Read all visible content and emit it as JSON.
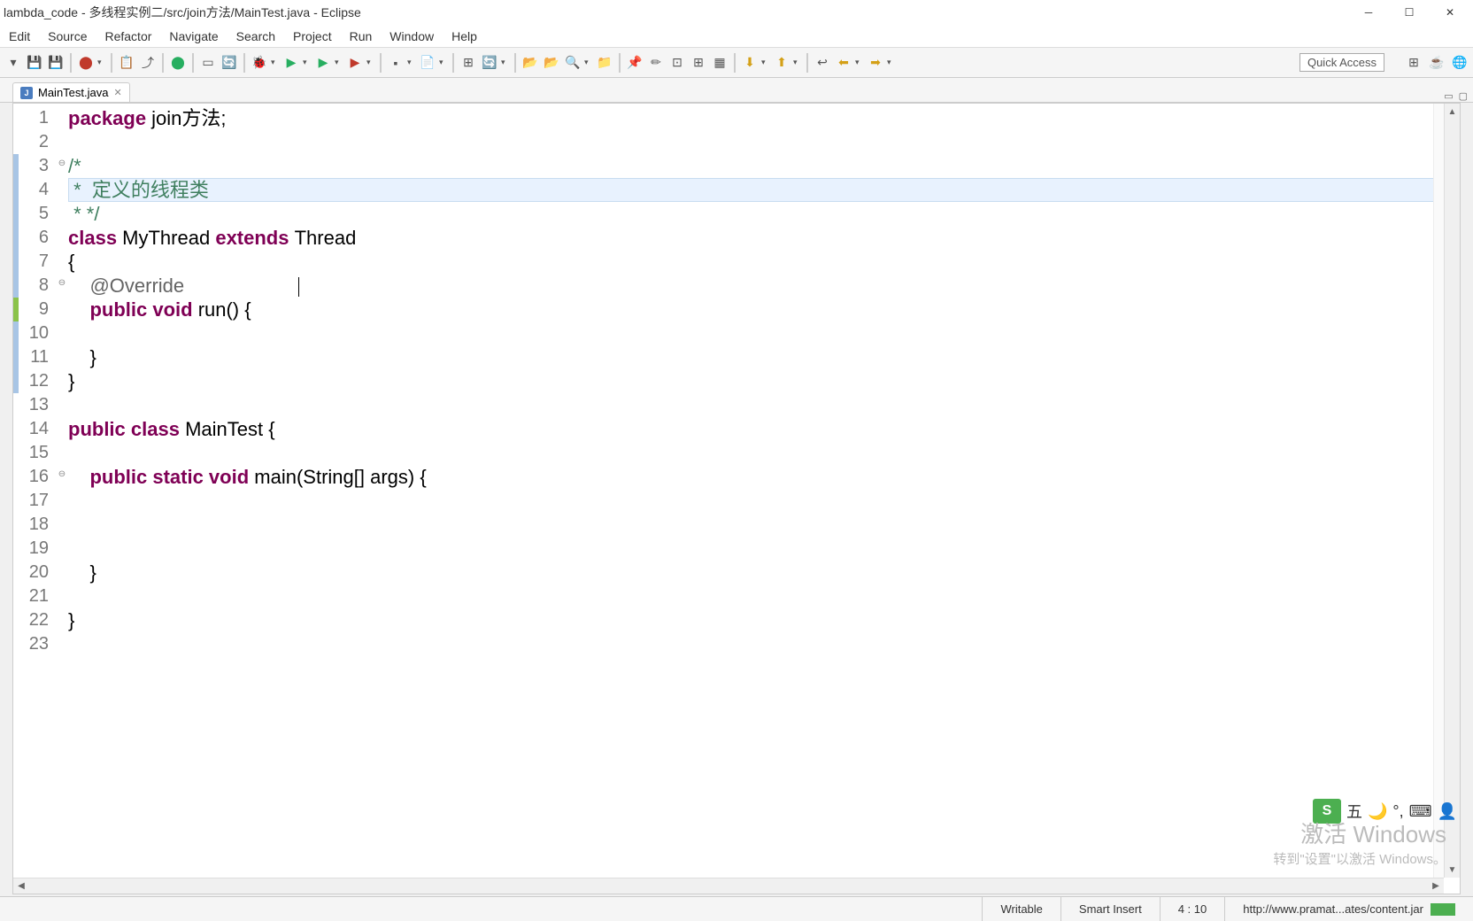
{
  "window": {
    "title": "lambda_code - 多线程实例二/src/join方法/MainTest.java - Eclipse"
  },
  "menu": {
    "items": [
      "Edit",
      "Source",
      "Refactor",
      "Navigate",
      "Search",
      "Project",
      "Run",
      "Window",
      "Help"
    ]
  },
  "toolbar": {
    "quick_access": "Quick Access"
  },
  "tabs": {
    "active": {
      "icon": "J",
      "label": "MainTest.java"
    }
  },
  "editor": {
    "lines": [
      {
        "n": "1",
        "tokens": [
          {
            "t": "package ",
            "c": "kw"
          },
          {
            "t": "join方法;",
            "c": ""
          }
        ]
      },
      {
        "n": "2",
        "tokens": []
      },
      {
        "n": "3",
        "tokens": [
          {
            "t": "/*",
            "c": "comment"
          }
        ],
        "fold": "⊖"
      },
      {
        "n": "4",
        "tokens": [
          {
            "t": " *  定义的线程类",
            "c": "comment"
          }
        ],
        "highlight": true
      },
      {
        "n": "5",
        "tokens": [
          {
            "t": " * */",
            "c": "comment"
          }
        ]
      },
      {
        "n": "6",
        "tokens": [
          {
            "t": "class ",
            "c": "kw"
          },
          {
            "t": "MyThread ",
            "c": ""
          },
          {
            "t": "extends ",
            "c": "kw"
          },
          {
            "t": "Thread",
            "c": ""
          }
        ]
      },
      {
        "n": "7",
        "tokens": [
          {
            "t": "{",
            "c": ""
          }
        ]
      },
      {
        "n": "8",
        "tokens": [
          {
            "t": "    ",
            "c": ""
          },
          {
            "t": "@Override",
            "c": "ann"
          }
        ],
        "fold": "⊖"
      },
      {
        "n": "9",
        "tokens": [
          {
            "t": "    ",
            "c": ""
          },
          {
            "t": "public void ",
            "c": "kw"
          },
          {
            "t": "run() {",
            "c": ""
          }
        ],
        "marker": "green"
      },
      {
        "n": "10",
        "tokens": []
      },
      {
        "n": "11",
        "tokens": [
          {
            "t": "    }",
            "c": ""
          }
        ]
      },
      {
        "n": "12",
        "tokens": [
          {
            "t": "}",
            "c": ""
          }
        ]
      },
      {
        "n": "13",
        "tokens": []
      },
      {
        "n": "14",
        "tokens": [
          {
            "t": "public class ",
            "c": "kw"
          },
          {
            "t": "MainTest {",
            "c": ""
          }
        ]
      },
      {
        "n": "15",
        "tokens": []
      },
      {
        "n": "16",
        "tokens": [
          {
            "t": "    ",
            "c": ""
          },
          {
            "t": "public static void ",
            "c": "kw"
          },
          {
            "t": "main(String[] args) {",
            "c": ""
          }
        ],
        "fold": "⊖"
      },
      {
        "n": "17",
        "tokens": []
      },
      {
        "n": "18",
        "tokens": []
      },
      {
        "n": "19",
        "tokens": []
      },
      {
        "n": "20",
        "tokens": [
          {
            "t": "    }",
            "c": ""
          }
        ]
      },
      {
        "n": "21",
        "tokens": []
      },
      {
        "n": "22",
        "tokens": [
          {
            "t": "}",
            "c": ""
          }
        ]
      },
      {
        "n": "23",
        "tokens": []
      }
    ],
    "cursor_visual_row": 8
  },
  "status": {
    "writable": "Writable",
    "insert": "Smart Insert",
    "position": "4 : 10",
    "url": "http://www.pramat...ates/content.jar"
  },
  "watermark": {
    "line1": "激活 Windows",
    "line2": "转到\"设置\"以激活 Windows。"
  },
  "ime": {
    "brand": "S",
    "mode": "五"
  }
}
